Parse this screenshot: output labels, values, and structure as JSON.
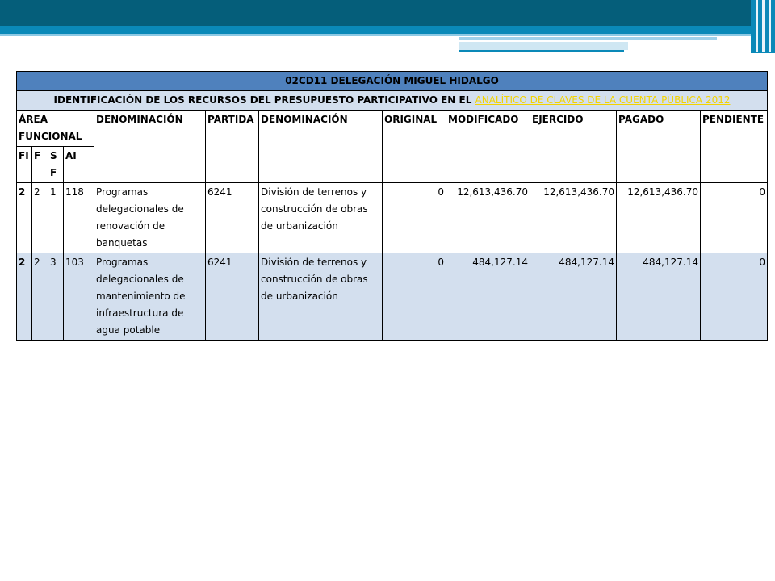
{
  "title": "02CD11 DELEGACIÓN MIGUEL HIDALGO",
  "subtitle_text": "IDENTIFICACIÓN DE LOS RECURSOS DEL PRESUPUESTO PARTICIPATIVO EN EL ",
  "subtitle_link": "ANALÍTICO DE CLAVES DE LA CUENTA PÚBLICA 2012",
  "headers": {
    "area_funcional": "ÁREA FUNCIONAL",
    "denominacion1": "DENOMINACIÓN",
    "partida": "PARTIDA",
    "denominacion2": "DENOMINACIÓN",
    "original": "ORIGINAL",
    "modificado": "MODIFICADO",
    "ejercido": "EJERCIDO",
    "pagado": "PAGADO",
    "pendiente": "PENDIENTE"
  },
  "subheaders": {
    "fi": "FI",
    "f": "F",
    "sf": "S F",
    "ai": "AI"
  },
  "rows": [
    {
      "fi": "2",
      "f": "2",
      "sf": "1",
      "ai": "118",
      "denominacion1": "Programas delegacionales de renovación de banquetas",
      "partida": "6241",
      "denominacion2": "División de terrenos y construcción de obras de urbanización",
      "original": "0",
      "modificado": "12,613,436.70",
      "ejercido": "12,613,436.70",
      "pagado": "12,613,436.70",
      "pendiente": "0"
    },
    {
      "fi": "2",
      "f": "2",
      "sf": "3",
      "ai": "103",
      "denominacion1": "Programas delegacionales de mantenimiento de infraestructura de agua potable",
      "partida": "6241",
      "denominacion2": "División de terrenos y construcción de obras de urbanización",
      "original": "0",
      "modificado": "484,127.14",
      "ejercido": "484,127.14",
      "pagado": "484,127.14",
      "pendiente": "0"
    }
  ],
  "colors": {
    "banner": "#055E7A",
    "accent": "#0A89B8",
    "title_fill": "#4F81BD",
    "row_fill": "#D3DFEE",
    "link": "#F3D300"
  }
}
